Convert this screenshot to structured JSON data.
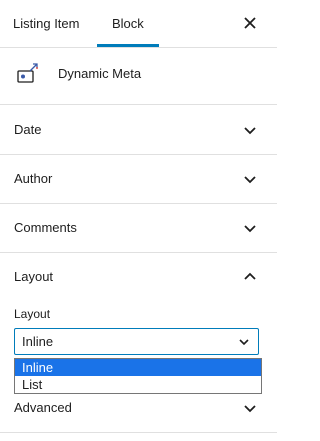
{
  "tabs": [
    {
      "label": "Listing Item",
      "active": false
    },
    {
      "label": "Block",
      "active": true
    }
  ],
  "accent_color": "#007cba",
  "block": {
    "title": "Dynamic Meta",
    "icon": "dynamic-meta-icon"
  },
  "panels": {
    "date": "Date",
    "author": "Author",
    "comments": "Comments",
    "layout": "Layout",
    "advanced": "Advanced"
  },
  "layout_field": {
    "label": "Layout",
    "selected": "Inline",
    "options": [
      "Inline",
      "List"
    ]
  }
}
